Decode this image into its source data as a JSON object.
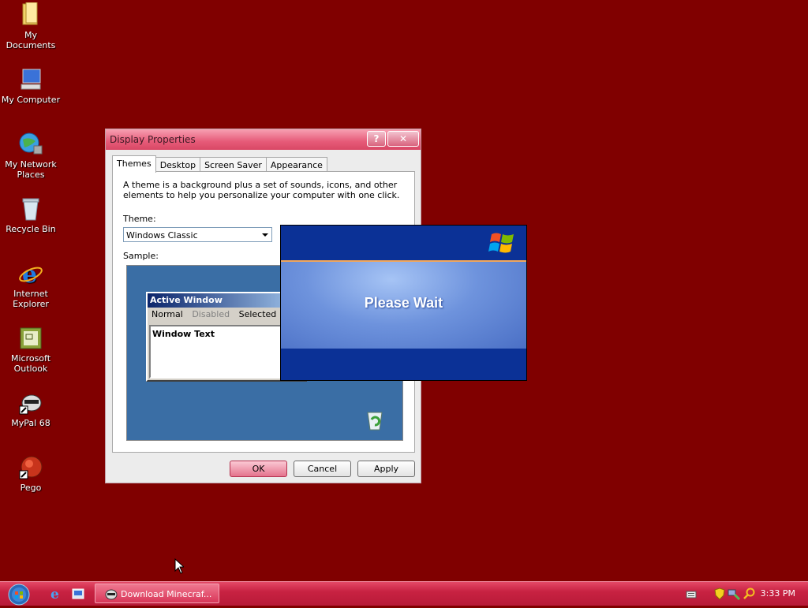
{
  "desktop": {
    "background": "#800000",
    "icons": [
      {
        "label": "My Documents",
        "icon": "folder-icon"
      },
      {
        "label": "My Computer",
        "icon": "computer-icon"
      },
      {
        "label": "My Network Places",
        "icon": "network-icon"
      },
      {
        "label": "Recycle Bin",
        "icon": "recycle-bin-icon"
      },
      {
        "label": "Internet Explorer",
        "icon": "ie-icon"
      },
      {
        "label": "Microsoft Outlook",
        "icon": "outlook-icon"
      },
      {
        "label": "MyPal 68",
        "icon": "mypal-icon"
      },
      {
        "label": "Pego",
        "icon": "pego-icon"
      }
    ]
  },
  "dialog": {
    "title": "Display Properties",
    "help_glyph": "?",
    "close_glyph": "✕",
    "tabs": [
      "Themes",
      "Desktop",
      "Screen Saver",
      "Appearance"
    ],
    "description": "A theme is a background plus a set of sounds, icons, and other elements to help you personalize your computer with one click.",
    "theme_label": "Theme:",
    "theme_value": "Windows Classic",
    "sample_label": "Sample:",
    "sample": {
      "window_title": "Active Window",
      "menu_normal": "Normal",
      "menu_disabled": "Disabled",
      "menu_selected": "Selected",
      "window_text": "Window Text"
    },
    "buttons": {
      "ok": "OK",
      "cancel": "Cancel",
      "apply": "Apply"
    }
  },
  "please_wait": {
    "text": "Please Wait"
  },
  "taskbar": {
    "task_button": "Download Minecraf...",
    "clock": "3:33 PM"
  }
}
